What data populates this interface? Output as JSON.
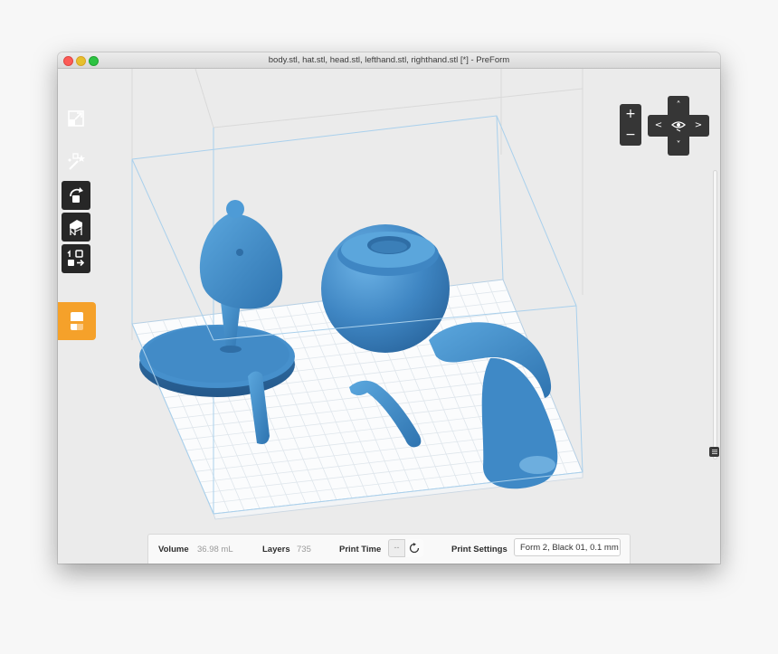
{
  "window": {
    "title": "body.stl, hat.stl, head.stl, lefthand.stl, righthand.stl [*] - PreForm"
  },
  "toolbar": {
    "tools": [
      {
        "name": "Fit to window",
        "icon": "expand-icon"
      },
      {
        "name": "One-click print",
        "icon": "magic-wand-icon"
      },
      {
        "name": "Orientation",
        "icon": "rotate-icon"
      },
      {
        "name": "Supports",
        "icon": "supports-icon"
      },
      {
        "name": "Layout",
        "icon": "layout-icon"
      },
      {
        "name": "Print",
        "icon": "print-icon"
      }
    ],
    "active_color": "#f5a12a"
  },
  "camera_controls": {
    "zoom_in": "+",
    "zoom_out": "−",
    "pan_up": "˄",
    "pan_down": "˅",
    "pan_left": "<",
    "pan_right": ">"
  },
  "scene": {
    "model_color": "#4a93cf",
    "build_volume_color": "#9cc8e8",
    "grid_color": "#cfdbe5"
  },
  "status": {
    "volume_label": "Volume",
    "volume_value": "36.98 mL",
    "layers_label": "Layers",
    "layers_value": "735",
    "print_time_label": "Print Time",
    "print_time_value": "--",
    "print_settings_label": "Print Settings",
    "print_settings_value": "Form 2, Black 01, 0.1 mm"
  }
}
